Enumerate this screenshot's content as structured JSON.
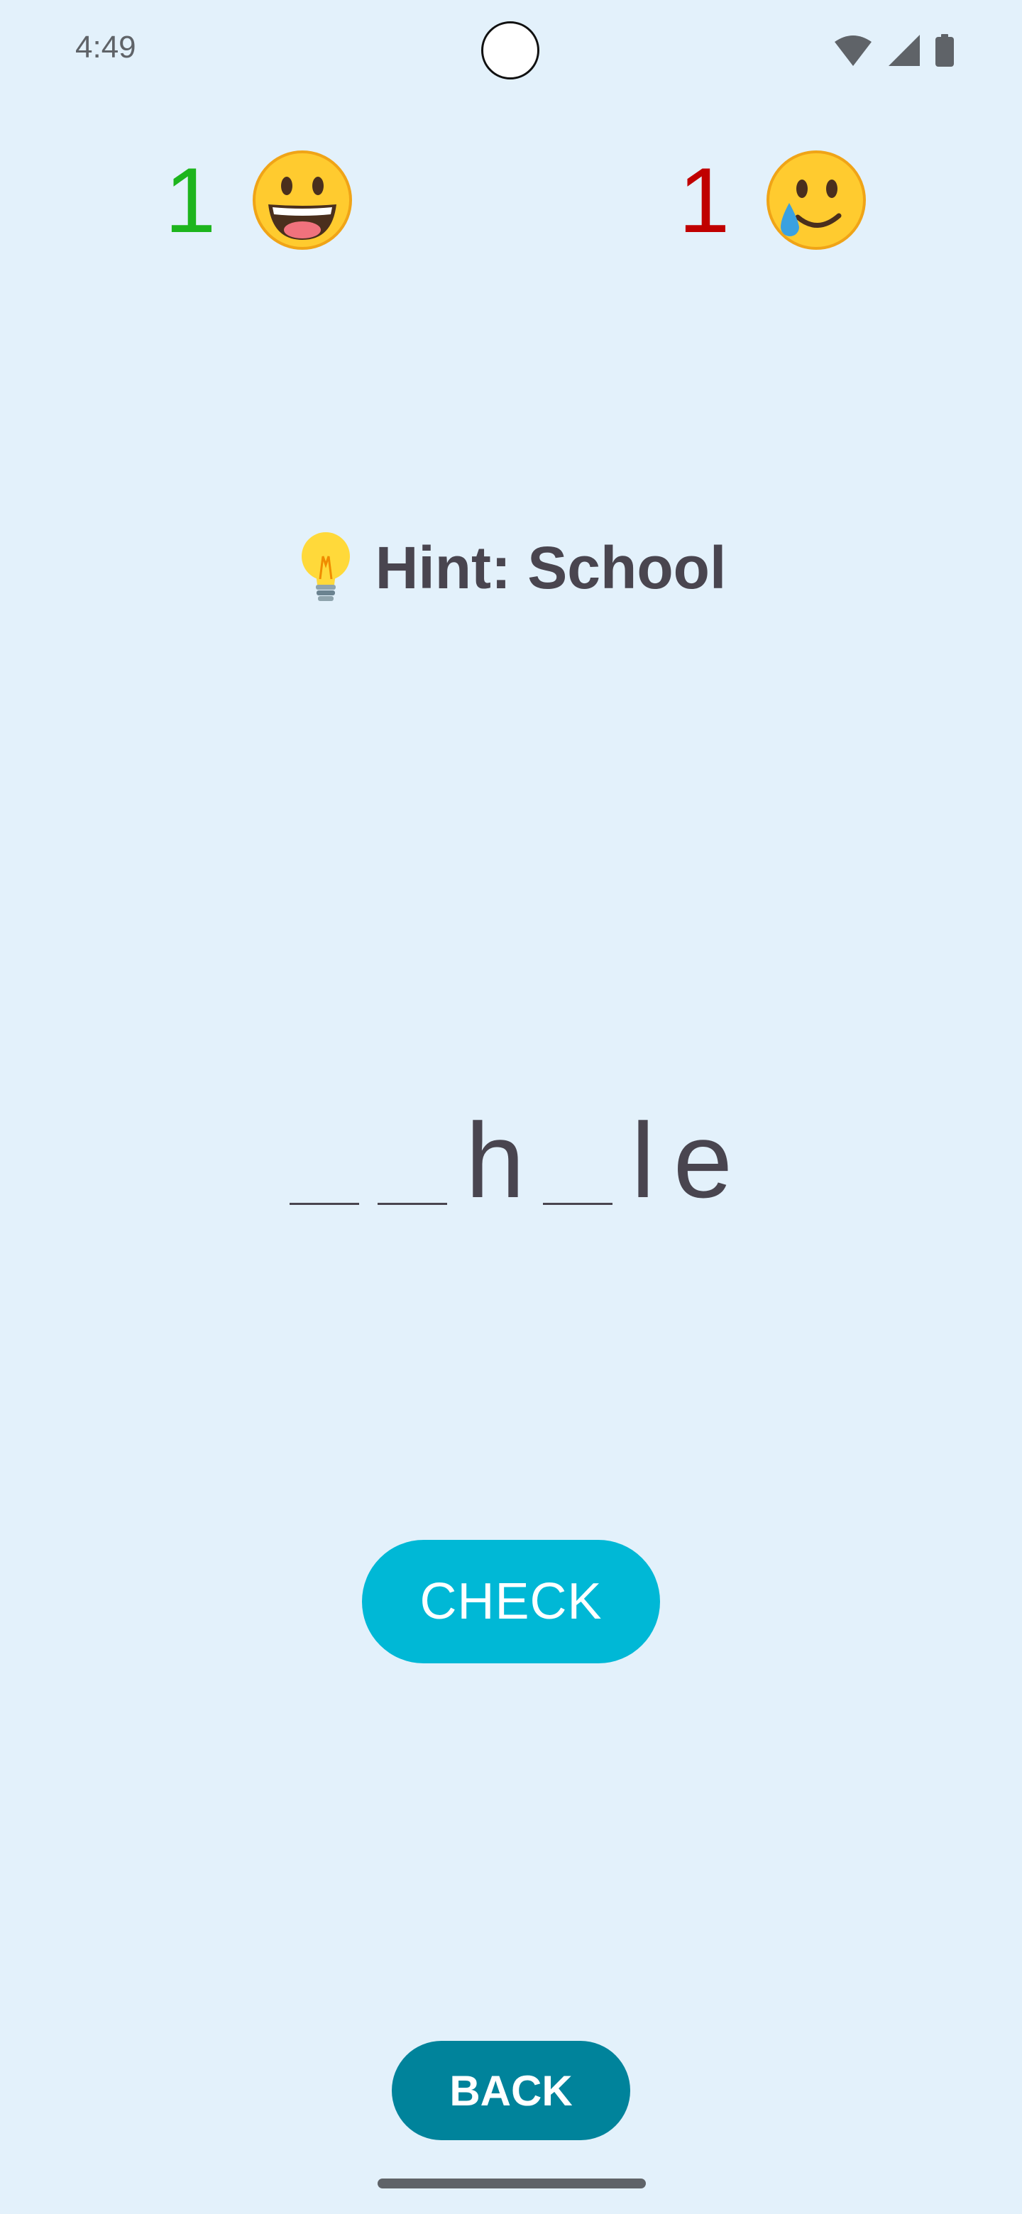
{
  "status_bar": {
    "time": "4:49",
    "icons": [
      "wifi-icon",
      "cellular-signal-icon",
      "battery-icon"
    ]
  },
  "scoreboard": {
    "correct": {
      "count": "1",
      "color": "#1db51d",
      "emoji": "grinning-face"
    },
    "wrong": {
      "count": "1",
      "color": "#c00000",
      "emoji": "smiling-face-with-tear"
    }
  },
  "hint": {
    "icon": "light-bulb-icon",
    "text": "Hint: School"
  },
  "puzzle": {
    "slots": [
      "",
      "",
      "h",
      "",
      "l",
      "e"
    ]
  },
  "buttons": {
    "check": "CHECK",
    "back": "BACK"
  },
  "colors": {
    "background": "#e3f1fb",
    "check_button": "#00b8d6",
    "back_button": "#00839b",
    "text": "#49454f"
  }
}
